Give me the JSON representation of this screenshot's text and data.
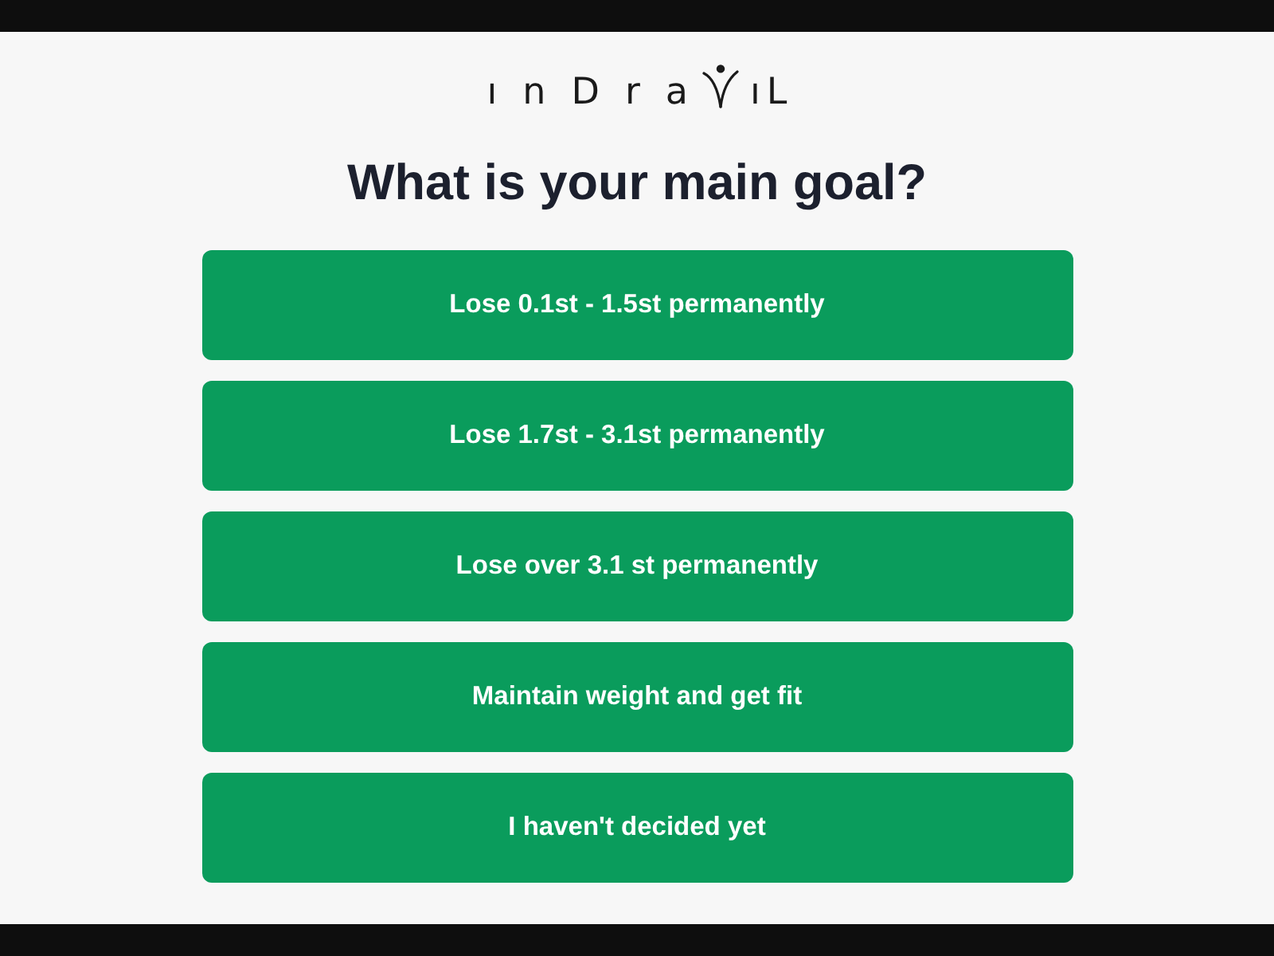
{
  "logo": {
    "text_start": "ınDra",
    "text_end": "ıL"
  },
  "title": "What is your main goal?",
  "options": [
    {
      "label": "Lose 0.1st - 1.5st permanently"
    },
    {
      "label": "Lose 1.7st - 3.1st permanently"
    },
    {
      "label": "Lose over 3.1 st permanently"
    },
    {
      "label": "Maintain weight and get fit"
    },
    {
      "label": "I haven't decided yet"
    }
  ]
}
